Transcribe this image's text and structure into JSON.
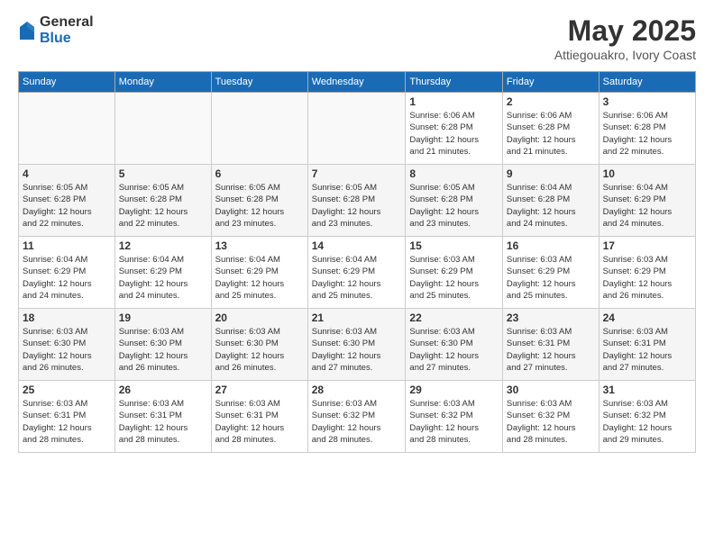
{
  "logo": {
    "general": "General",
    "blue": "Blue"
  },
  "header": {
    "month": "May 2025",
    "location": "Attiegouakro, Ivory Coast"
  },
  "weekdays": [
    "Sunday",
    "Monday",
    "Tuesday",
    "Wednesday",
    "Thursday",
    "Friday",
    "Saturday"
  ],
  "weeks": [
    [
      {
        "day": "",
        "info": ""
      },
      {
        "day": "",
        "info": ""
      },
      {
        "day": "",
        "info": ""
      },
      {
        "day": "",
        "info": ""
      },
      {
        "day": "1",
        "info": "Sunrise: 6:06 AM\nSunset: 6:28 PM\nDaylight: 12 hours\nand 21 minutes."
      },
      {
        "day": "2",
        "info": "Sunrise: 6:06 AM\nSunset: 6:28 PM\nDaylight: 12 hours\nand 21 minutes."
      },
      {
        "day": "3",
        "info": "Sunrise: 6:06 AM\nSunset: 6:28 PM\nDaylight: 12 hours\nand 22 minutes."
      }
    ],
    [
      {
        "day": "4",
        "info": "Sunrise: 6:05 AM\nSunset: 6:28 PM\nDaylight: 12 hours\nand 22 minutes."
      },
      {
        "day": "5",
        "info": "Sunrise: 6:05 AM\nSunset: 6:28 PM\nDaylight: 12 hours\nand 22 minutes."
      },
      {
        "day": "6",
        "info": "Sunrise: 6:05 AM\nSunset: 6:28 PM\nDaylight: 12 hours\nand 23 minutes."
      },
      {
        "day": "7",
        "info": "Sunrise: 6:05 AM\nSunset: 6:28 PM\nDaylight: 12 hours\nand 23 minutes."
      },
      {
        "day": "8",
        "info": "Sunrise: 6:05 AM\nSunset: 6:28 PM\nDaylight: 12 hours\nand 23 minutes."
      },
      {
        "day": "9",
        "info": "Sunrise: 6:04 AM\nSunset: 6:28 PM\nDaylight: 12 hours\nand 24 minutes."
      },
      {
        "day": "10",
        "info": "Sunrise: 6:04 AM\nSunset: 6:29 PM\nDaylight: 12 hours\nand 24 minutes."
      }
    ],
    [
      {
        "day": "11",
        "info": "Sunrise: 6:04 AM\nSunset: 6:29 PM\nDaylight: 12 hours\nand 24 minutes."
      },
      {
        "day": "12",
        "info": "Sunrise: 6:04 AM\nSunset: 6:29 PM\nDaylight: 12 hours\nand 24 minutes."
      },
      {
        "day": "13",
        "info": "Sunrise: 6:04 AM\nSunset: 6:29 PM\nDaylight: 12 hours\nand 25 minutes."
      },
      {
        "day": "14",
        "info": "Sunrise: 6:04 AM\nSunset: 6:29 PM\nDaylight: 12 hours\nand 25 minutes."
      },
      {
        "day": "15",
        "info": "Sunrise: 6:03 AM\nSunset: 6:29 PM\nDaylight: 12 hours\nand 25 minutes."
      },
      {
        "day": "16",
        "info": "Sunrise: 6:03 AM\nSunset: 6:29 PM\nDaylight: 12 hours\nand 25 minutes."
      },
      {
        "day": "17",
        "info": "Sunrise: 6:03 AM\nSunset: 6:29 PM\nDaylight: 12 hours\nand 26 minutes."
      }
    ],
    [
      {
        "day": "18",
        "info": "Sunrise: 6:03 AM\nSunset: 6:30 PM\nDaylight: 12 hours\nand 26 minutes."
      },
      {
        "day": "19",
        "info": "Sunrise: 6:03 AM\nSunset: 6:30 PM\nDaylight: 12 hours\nand 26 minutes."
      },
      {
        "day": "20",
        "info": "Sunrise: 6:03 AM\nSunset: 6:30 PM\nDaylight: 12 hours\nand 26 minutes."
      },
      {
        "day": "21",
        "info": "Sunrise: 6:03 AM\nSunset: 6:30 PM\nDaylight: 12 hours\nand 27 minutes."
      },
      {
        "day": "22",
        "info": "Sunrise: 6:03 AM\nSunset: 6:30 PM\nDaylight: 12 hours\nand 27 minutes."
      },
      {
        "day": "23",
        "info": "Sunrise: 6:03 AM\nSunset: 6:31 PM\nDaylight: 12 hours\nand 27 minutes."
      },
      {
        "day": "24",
        "info": "Sunrise: 6:03 AM\nSunset: 6:31 PM\nDaylight: 12 hours\nand 27 minutes."
      }
    ],
    [
      {
        "day": "25",
        "info": "Sunrise: 6:03 AM\nSunset: 6:31 PM\nDaylight: 12 hours\nand 28 minutes."
      },
      {
        "day": "26",
        "info": "Sunrise: 6:03 AM\nSunset: 6:31 PM\nDaylight: 12 hours\nand 28 minutes."
      },
      {
        "day": "27",
        "info": "Sunrise: 6:03 AM\nSunset: 6:31 PM\nDaylight: 12 hours\nand 28 minutes."
      },
      {
        "day": "28",
        "info": "Sunrise: 6:03 AM\nSunset: 6:32 PM\nDaylight: 12 hours\nand 28 minutes."
      },
      {
        "day": "29",
        "info": "Sunrise: 6:03 AM\nSunset: 6:32 PM\nDaylight: 12 hours\nand 28 minutes."
      },
      {
        "day": "30",
        "info": "Sunrise: 6:03 AM\nSunset: 6:32 PM\nDaylight: 12 hours\nand 28 minutes."
      },
      {
        "day": "31",
        "info": "Sunrise: 6:03 AM\nSunset: 6:32 PM\nDaylight: 12 hours\nand 29 minutes."
      }
    ]
  ]
}
